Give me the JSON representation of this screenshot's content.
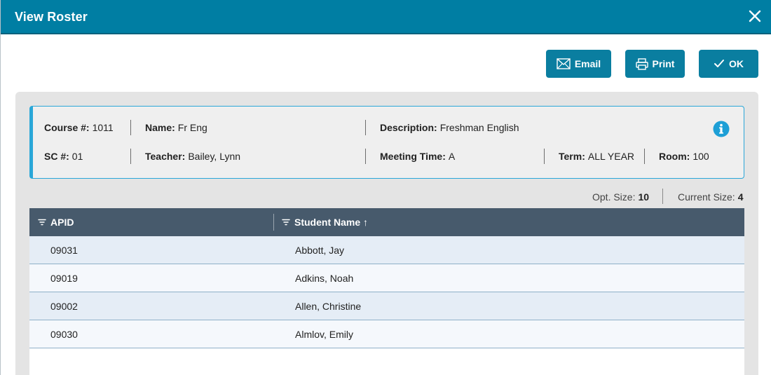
{
  "dialog": {
    "title": "View Roster"
  },
  "toolbar": {
    "email_label": "Email",
    "print_label": "Print",
    "ok_label": "OK"
  },
  "course": {
    "course_num_label": "Course #:",
    "course_num": "1011",
    "name_label": "Name:",
    "name": "Fr Eng",
    "description_label": "Description:",
    "description": "Freshman English",
    "sc_label": "SC #:",
    "sc": "01",
    "teacher_label": "Teacher:",
    "teacher": "Bailey, Lynn",
    "meeting_label": "Meeting Time:",
    "meeting": "A",
    "term_label": "Term:",
    "term": "ALL YEAR",
    "room_label": "Room:",
    "room": "100"
  },
  "sizes": {
    "opt_label": "Opt. Size:",
    "opt_value": "10",
    "current_label": "Current Size:",
    "current_value": "4"
  },
  "table": {
    "columns": [
      "APID",
      "Student Name ↑"
    ],
    "rows": [
      {
        "apid": "09031",
        "name": "Abbott, Jay"
      },
      {
        "apid": "09019",
        "name": "Adkins, Noah"
      },
      {
        "apid": "09002",
        "name": "Allen, Christine"
      },
      {
        "apid": "09030",
        "name": "Almlov, Emily"
      }
    ]
  },
  "colors": {
    "header_bg": "#007ea3",
    "button_bg": "#0a7ea0",
    "table_header_bg": "#475a6c",
    "accent_border": "#2aa7d8"
  },
  "icons": [
    "close-icon",
    "email-icon",
    "print-icon",
    "check-icon",
    "info-icon",
    "filter-icon"
  ]
}
